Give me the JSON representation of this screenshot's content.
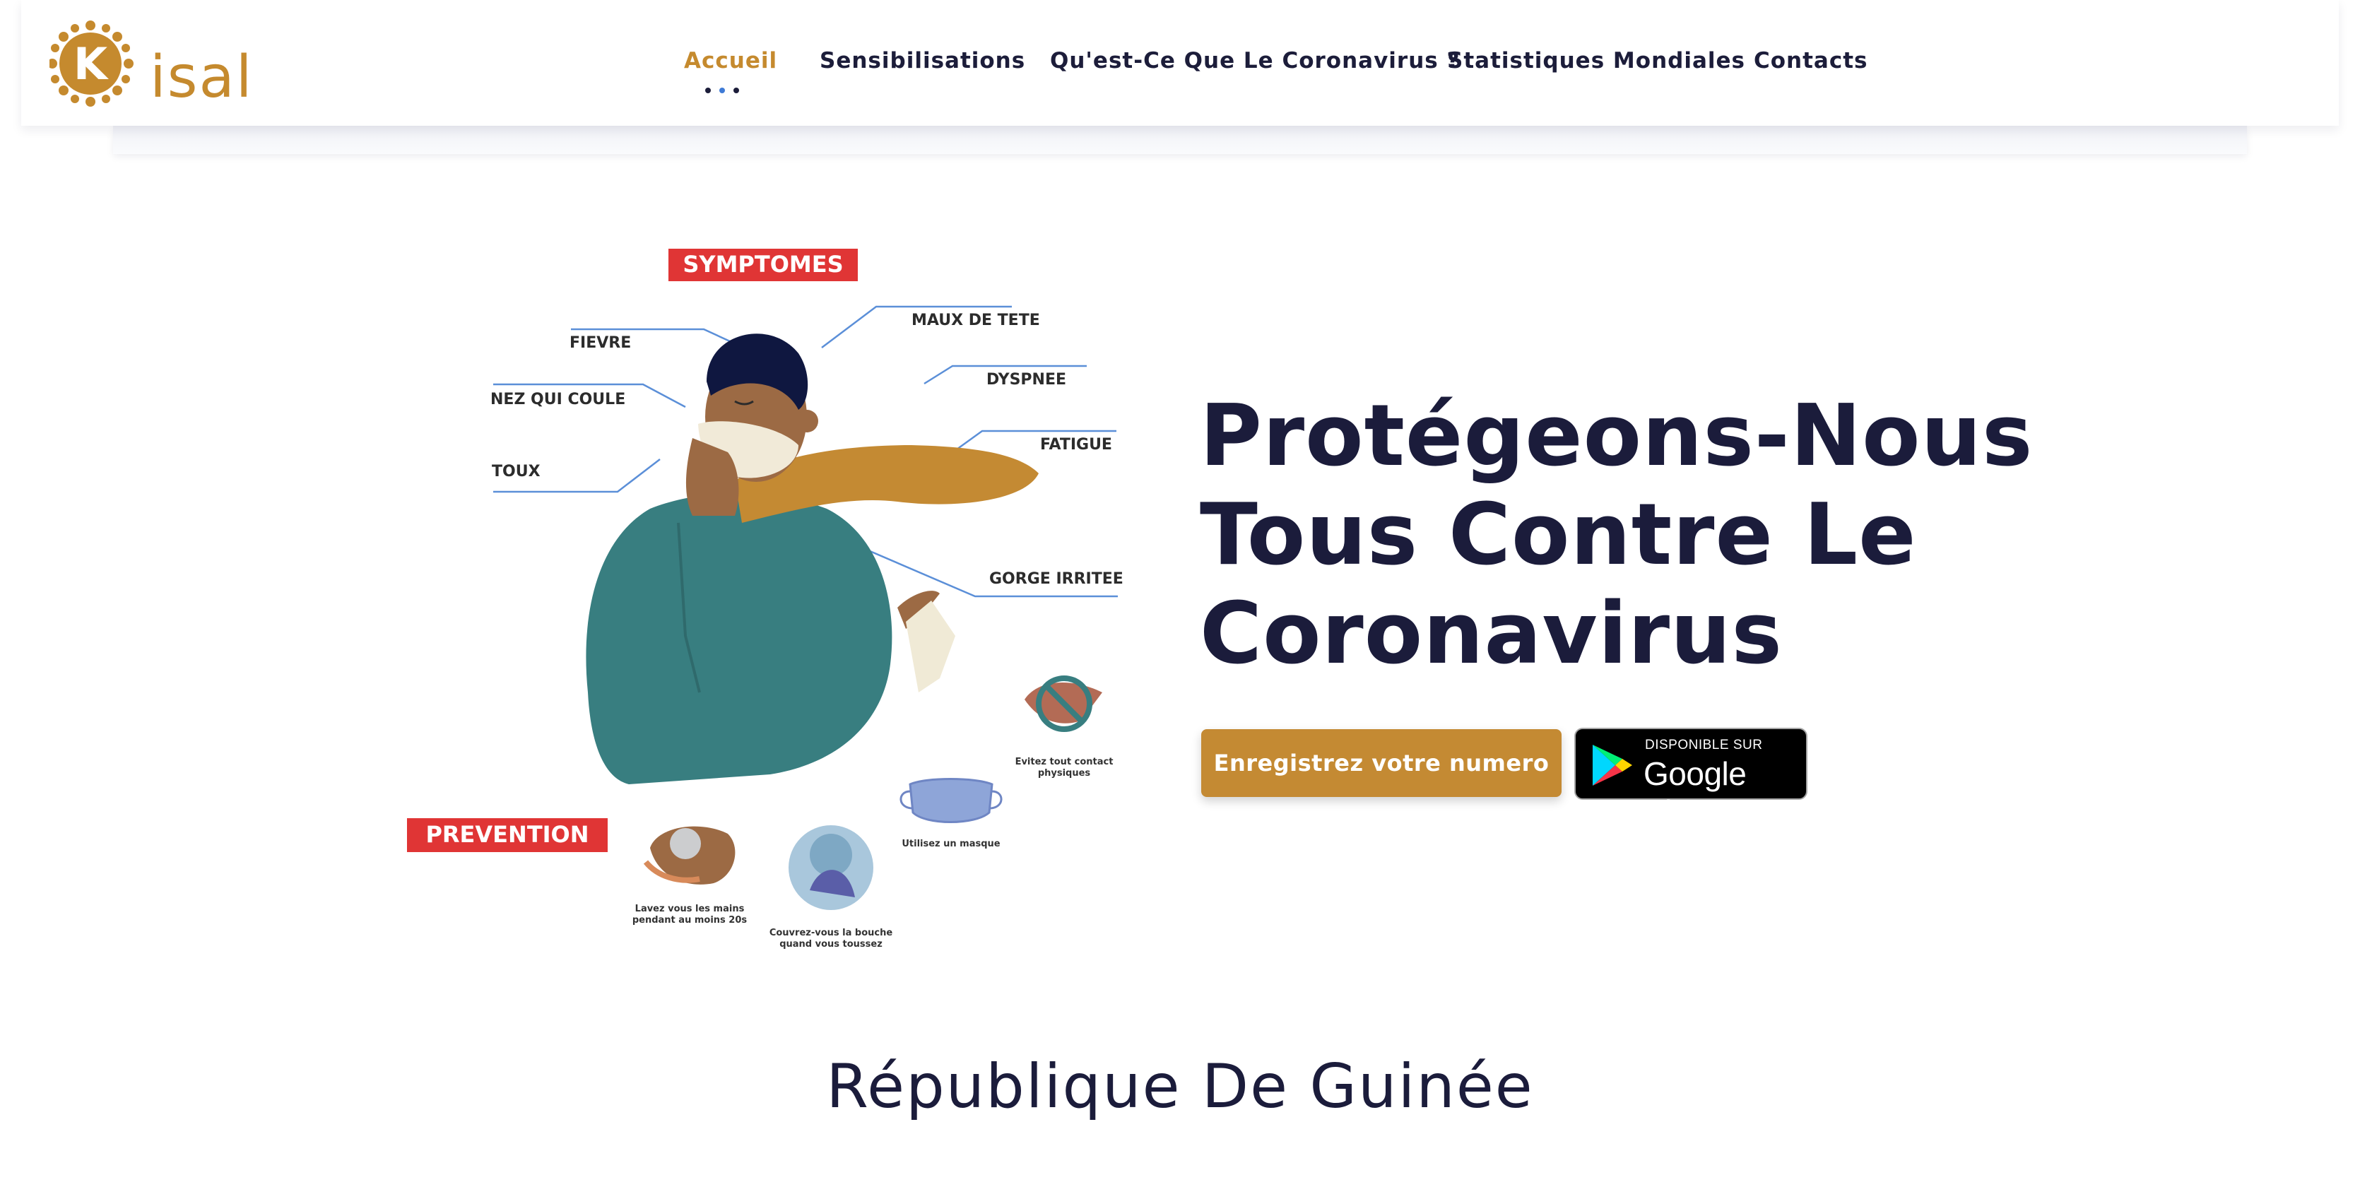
{
  "brand": {
    "name": "isal",
    "logo_initial": "K",
    "color": "#c58a2e"
  },
  "nav": {
    "items": [
      {
        "label": "Accueil",
        "active": true
      },
      {
        "label": "Sensibilisations",
        "active": false
      },
      {
        "label": "Qu'est-Ce Que Le Coronavirus ?",
        "active": false
      },
      {
        "label": "Statistiques Mondiales",
        "active": false
      },
      {
        "label": "Contacts",
        "active": false
      }
    ]
  },
  "hero": {
    "title_lines": [
      "Protégeons-Nous",
      "Tous Contre Le",
      "Coronavirus"
    ],
    "cta_label": "Enregistrez votre numero",
    "store_badge": {
      "small": "DISPONIBLE SUR",
      "big": "Google Play"
    }
  },
  "illustration": {
    "symptoms_title": "SYMPTOMES",
    "symptoms": [
      "FIEVRE",
      "MAUX DE TETE",
      "DYSPNEE",
      "NEZ QUI COULE",
      "TOUX",
      "FATIGUE",
      "GORGE IRRITEE"
    ],
    "prevention_title": "PREVENTION",
    "tips": {
      "contact": [
        "Evitez tout contact",
        "physiques"
      ],
      "mask": [
        "Utilisez un masque"
      ],
      "wash": [
        "Lavez vous les mains",
        "pendant au moins 20s"
      ],
      "cough": [
        "Couvrez-vous la bouche",
        "quand vous toussez"
      ]
    }
  },
  "section": {
    "title": "République De Guinée"
  },
  "colors": {
    "accent": "#c58a2e",
    "dark": "#1b1c3b",
    "red": "#e03535",
    "teal": "#387e80"
  }
}
